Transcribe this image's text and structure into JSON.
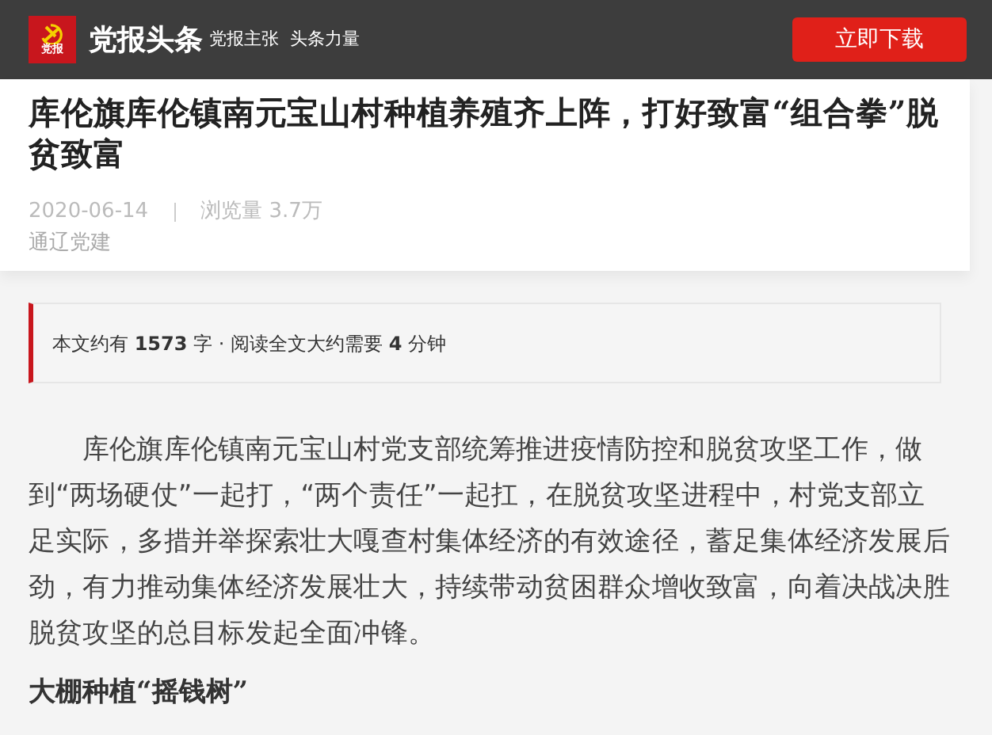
{
  "header": {
    "logo_text": "党报",
    "brand": "党报头条",
    "slogan": "党报主张  头条力量",
    "download_button": "立即下载"
  },
  "article": {
    "title": "库伦旗库伦镇南元宝山村种植养殖齐上阵，打好致富“组合拳”脱贫致富",
    "date": "2020-06-14",
    "views": "浏览量 3.7万",
    "source": "通辽党建"
  },
  "reading_info": "本文约有 **1573** 字 · 阅读全文大约需要 **4** 分钟",
  "paragraphs": [
    {
      "kind": "body",
      "text": "库伦旗库伦镇南元宝山村党支部统筹推进疫情防控和脱贫攻坚工作，做到“两场硬仗”一起打，“两个责任”一起扛，在脱贫攻坚进程中，村党支部立足实际，多措并举探索壮大嘎查村集体经济的有效途径，蓄足集体经济发展后劲，有力推动集体经济发展壮大，持续带动贫困群众增收致富，向着决战决胜脱贫攻坚的总目标发起全面冲锋。"
    },
    {
      "kind": "heading",
      "text": "大棚种植“摇钱树”"
    }
  ]
}
